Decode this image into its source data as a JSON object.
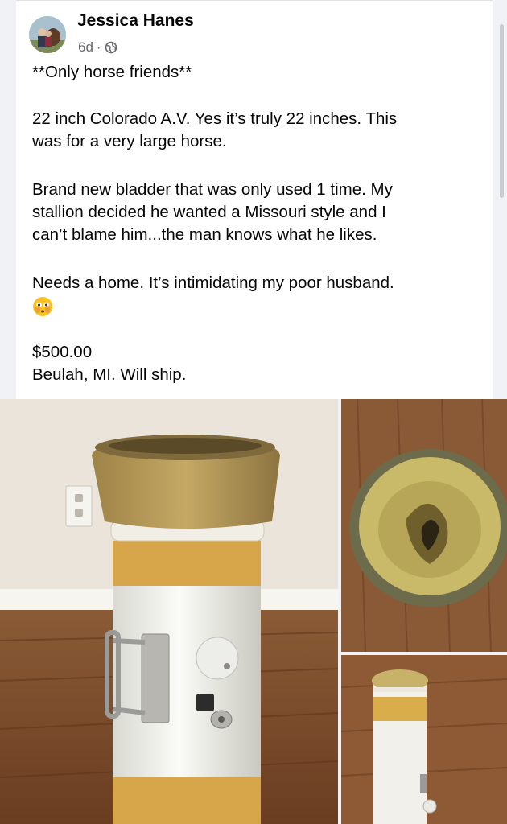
{
  "post": {
    "author": "Jessica Hanes",
    "time": "6d",
    "separator": "·",
    "audience_icon": "globe-icon",
    "lines": [
      "**Only horse friends**",
      "22 inch Colorado A.V. Yes it’s truly 22 inches. This",
      "was for a very large horse.",
      "Brand new bladder that was only used 1 time. My",
      "stallion decided he wanted a Missouri style and I",
      "can’t blame him...the man knows what he likes.",
      "Needs a home. It’s intimidating my poor husband.",
      "$500.00",
      "Beulah, MI. Will ship."
    ],
    "emoji": "flushed-face-emoji"
  },
  "photos": [
    {
      "name": "photo-main",
      "subject": "white tube with yellow rubber top and metal handle"
    },
    {
      "name": "photo-top-view",
      "subject": "top-down view into the yellow opening"
    },
    {
      "name": "photo-side-view",
      "subject": "tube lying on wooden floor"
    }
  ],
  "colors": {
    "text": "#050505",
    "meta": "#65676b",
    "floor": "#7a4a2a",
    "wall": "#e9e1d6",
    "rubber": "#b89a56",
    "tape": "#d9ad4a",
    "pipe": "#f3f3ef"
  }
}
